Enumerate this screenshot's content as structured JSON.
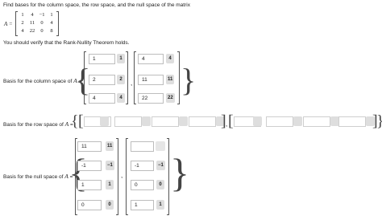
{
  "question": {
    "prompt": "Find bases for the column space, the row space, and the null space of the matrix",
    "matrix_label": "A =",
    "matrix": [
      [
        "1",
        "4",
        "−1",
        "1"
      ],
      [
        "2",
        "11",
        "0",
        "4"
      ],
      [
        "4",
        "22",
        "0",
        "8"
      ]
    ],
    "verify_note": "You should verify that the Rank-Nullity Theorem holds."
  },
  "column_space": {
    "label": "Basis for the column space of A =",
    "vectors": [
      [
        {
          "value": "1",
          "chip": "1"
        },
        {
          "value": "2",
          "chip": "2"
        },
        {
          "value": "4",
          "chip": "4"
        }
      ],
      [
        {
          "value": "4",
          "chip": "4"
        },
        {
          "value": "11",
          "chip": "11"
        },
        {
          "value": "22",
          "chip": "22"
        }
      ]
    ]
  },
  "row_space": {
    "label": "Basis for the row space of A ="
  },
  "null_space": {
    "label": "Basis for the null space of A =",
    "vectors": [
      [
        {
          "value": "11",
          "chip": "11"
        },
        {
          "value": "-1",
          "chip": "−1"
        },
        {
          "value": "1",
          "chip": "1"
        },
        {
          "value": "0",
          "chip": "0"
        }
      ],
      [
        {
          "value": "",
          "chip": ""
        },
        {
          "value": "-1",
          "chip": "−1"
        },
        {
          "value": "0",
          "chip": "0"
        },
        {
          "value": "1",
          "chip": "1"
        }
      ]
    ]
  }
}
